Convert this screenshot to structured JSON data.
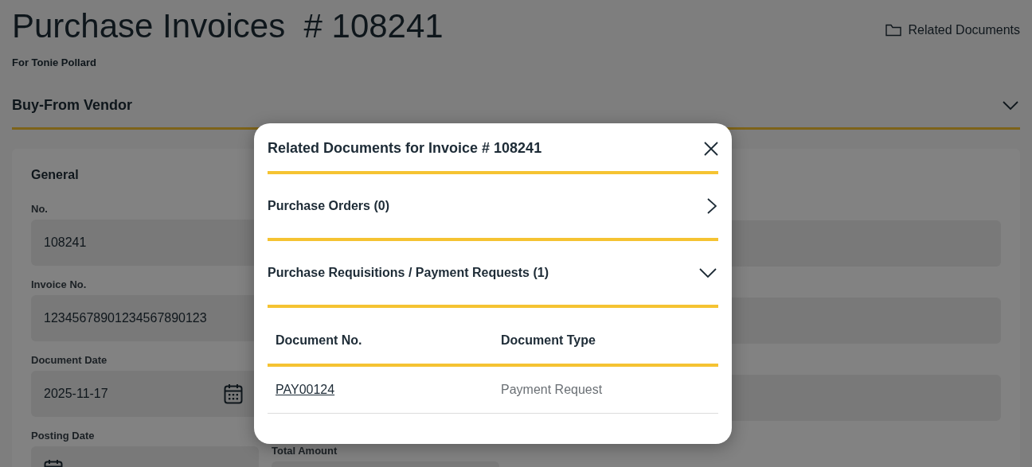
{
  "page": {
    "title": "Purchase Invoices  # 108241",
    "subtitle": "For Tonie Pollard",
    "related_link": "Related Documents"
  },
  "section": {
    "title": "Buy-From Vendor",
    "expanded": true
  },
  "card": {
    "title": "General",
    "left_fields": [
      {
        "label": "No.",
        "value": "108241",
        "kind": "text"
      },
      {
        "label": "Invoice No.",
        "value": "12345678901234567890123",
        "kind": "text"
      },
      {
        "label": "Document Date",
        "value": "2025-11-17",
        "kind": "date"
      },
      {
        "label": "Posting Date",
        "kind": "date"
      }
    ],
    "middle_label": "Total Amount"
  },
  "modal": {
    "title": "Related Documents for Invoice # 108241",
    "sections": [
      {
        "title": "Purchase Orders (0)",
        "expanded": false
      },
      {
        "title": "Purchase Requisitions / Payment Requests (1)",
        "expanded": true,
        "table": {
          "columns": [
            "Document No.",
            "Document Type"
          ],
          "rows": [
            {
              "document_no": "PAY00124",
              "document_type": "Payment Request"
            }
          ]
        }
      }
    ]
  }
}
